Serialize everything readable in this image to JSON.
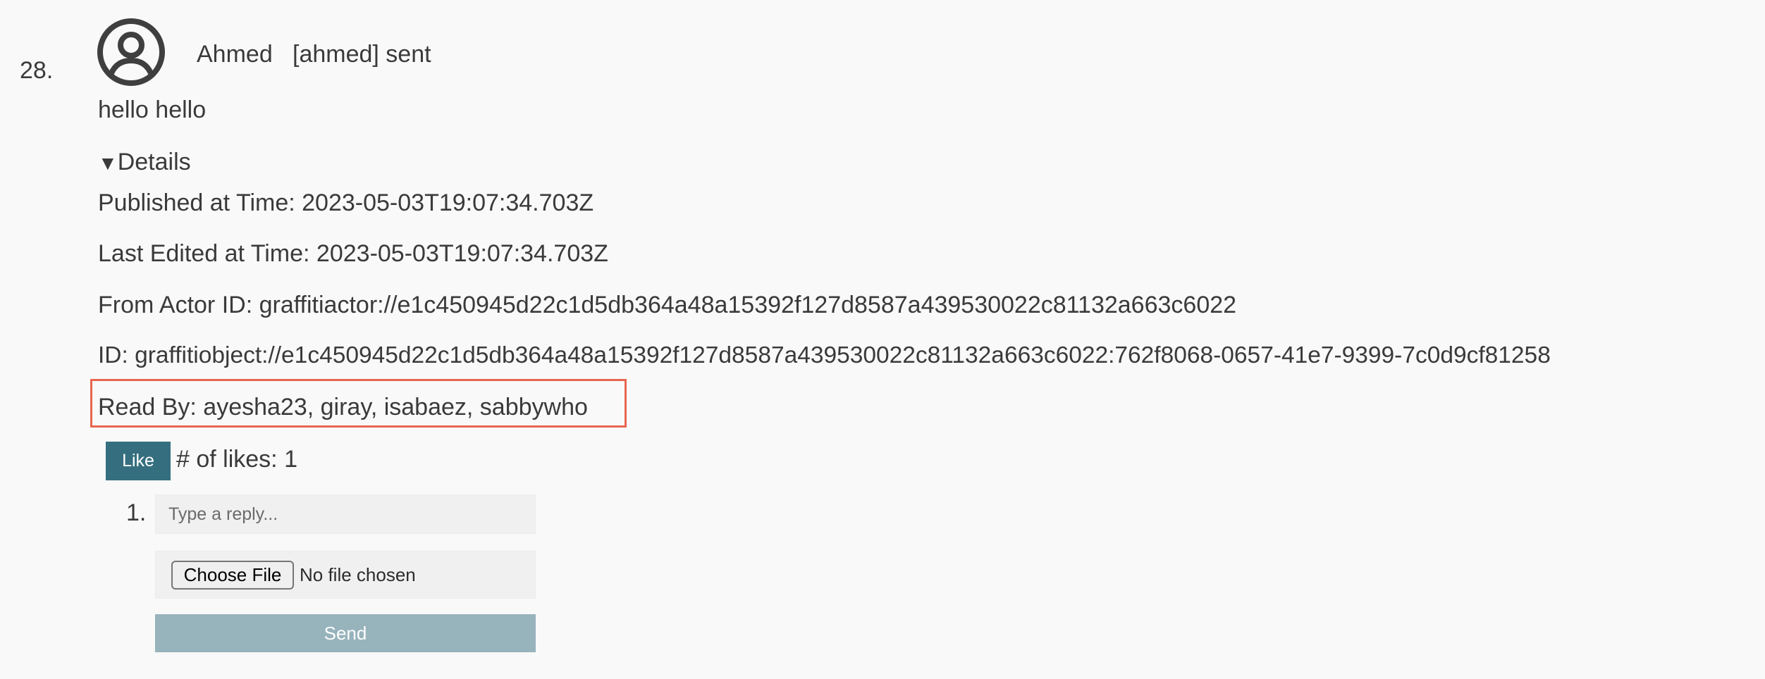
{
  "post": {
    "index": "28.",
    "author_name": "Ahmed",
    "action_text": "[ahmed] sent",
    "message": "hello hello",
    "avatar_icon": "user-circle-icon"
  },
  "details": {
    "summary_marker": "▼",
    "summary_label": "Details",
    "published": "Published at Time: 2023-05-03T19:07:34.703Z",
    "last_edited": "Last Edited at Time: 2023-05-03T19:07:34.703Z",
    "from_actor": "From Actor ID: graffitiactor://e1c450945d22c1d5db364a48a15392f127d8587a439530022c81132a663c6022",
    "id": "ID: graffitiobject://e1c450945d22c1d5db364a48a15392f127d8587a439530022c81132a663c6022:762f8068-0657-41e7-9399-7c0d9cf81258",
    "read_by": "Read By: ayesha23, giray, isabaez, sabbywho",
    "highlight_color": "#e8664f"
  },
  "likes": {
    "button_label": "Like",
    "count_text": "# of likes: 1"
  },
  "reply": {
    "list_index": "1.",
    "placeholder": "Type a reply...",
    "file_button_label": "Choose File",
    "file_status": "No file chosen",
    "send_label": "Send"
  },
  "colors": {
    "background": "#f9f9f9",
    "like_button": "#356f7f",
    "send_button_disabled": "#97b3bc",
    "text": "#3a3a3a"
  }
}
